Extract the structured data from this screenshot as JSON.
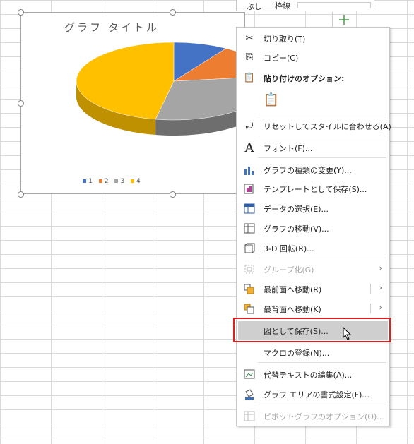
{
  "sheet": {
    "top_menu_text1": "ぶし",
    "top_menu_text2": "枠線"
  },
  "chart": {
    "title": "グラフ タイトル",
    "colors": {
      "s1": "#4472C4",
      "s2": "#ED7D31",
      "s3": "#A5A5A5",
      "s4": "#FFC000"
    }
  },
  "chart_data": {
    "type": "pie",
    "title": "グラフ タイトル",
    "categories": [
      "1",
      "2",
      "3",
      "4"
    ],
    "values": [
      9,
      14,
      30,
      47
    ]
  },
  "context_menu": {
    "items": [
      {
        "icon": "scissors-icon",
        "label": "切り取り(T)"
      },
      {
        "icon": "copy-icon",
        "label": "コピー(C)"
      },
      {
        "icon": "paste-icon",
        "label": "貼り付けのオプション:"
      },
      {
        "icon": "reset-style-icon",
        "label": "リセットしてスタイルに合わせる(A)"
      },
      {
        "icon": "font-icon",
        "label": "フォント(F)..."
      },
      {
        "icon": "chart-type-icon",
        "label": "グラフの種類の変更(Y)..."
      },
      {
        "icon": "template-icon",
        "label": "テンプレートとして保存(S)..."
      },
      {
        "icon": "select-data-icon",
        "label": "データの選択(E)..."
      },
      {
        "icon": "move-chart-icon",
        "label": "グラフの移動(V)..."
      },
      {
        "icon": "rotate-3d-icon",
        "label": "3-D 回転(R)..."
      },
      {
        "icon": "group-icon",
        "label": "グループ化(G)"
      },
      {
        "icon": "bring-front-icon",
        "label": "最前面へ移動(R)"
      },
      {
        "icon": "send-back-icon",
        "label": "最背面へ移動(K)"
      },
      {
        "icon": "save-picture-icon",
        "label": "図として保存(S)..."
      },
      {
        "icon": "macro-icon",
        "label": "マクロの登録(N)..."
      },
      {
        "icon": "alt-text-icon",
        "label": "代替テキストの編集(A)..."
      },
      {
        "icon": "format-area-icon",
        "label": "グラフ エリアの書式設定(F)..."
      },
      {
        "icon": "pivot-options-icon",
        "label": "ピボットグラフのオプション(O)..."
      }
    ]
  }
}
